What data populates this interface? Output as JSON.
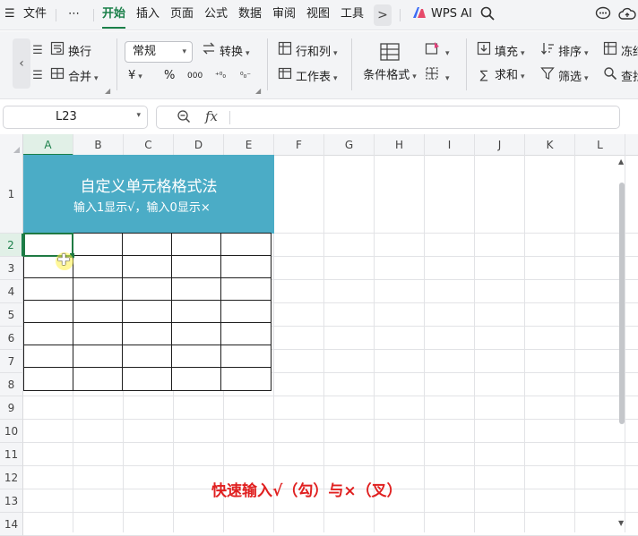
{
  "menu": {
    "items": [
      {
        "label": "文件",
        "name": "menu-file"
      },
      {
        "label": "开始",
        "name": "tab-home",
        "active": true
      },
      {
        "label": "插入",
        "name": "tab-insert"
      },
      {
        "label": "页面",
        "name": "tab-page"
      },
      {
        "label": "公式",
        "name": "tab-formula"
      },
      {
        "label": "数据",
        "name": "tab-data"
      },
      {
        "label": "审阅",
        "name": "tab-review"
      },
      {
        "label": "视图",
        "name": "tab-view"
      },
      {
        "label": "工具",
        "name": "tab-tools"
      }
    ],
    "more_label": "⋯",
    "overflow_label": ">",
    "wps_ai_label": "WPS AI"
  },
  "ribbon": {
    "wrap_label": "换行",
    "merge_label": "合并",
    "number_format": "常规",
    "convert_label": "转换",
    "rows_cols_label": "行和列",
    "worksheet_label": "工作表",
    "cond_format_label": "条件格式",
    "fill_label": "填充",
    "sum_label": "求和",
    "sort_label": "排序",
    "filter_label": "筛选",
    "freeze_label": "冻结",
    "find_label": "查找",
    "currency_symbol": "¥",
    "percent_symbol": "%",
    "thousands_symbol": "000"
  },
  "formula_bar": {
    "cell_ref": "L23",
    "fx_label": "fx",
    "content": ""
  },
  "sheet": {
    "columns": [
      "A",
      "B",
      "C",
      "D",
      "E",
      "F",
      "G",
      "H",
      "I",
      "J",
      "K",
      "L"
    ],
    "rows": [
      "1",
      "2",
      "3",
      "4",
      "5",
      "6",
      "7",
      "8",
      "9",
      "10",
      "11",
      "12",
      "13",
      "14"
    ],
    "title": "自定义单元格格式法",
    "subtitle": "输入1显示√，输入0显示×",
    "caption": "快速输入√（勾）与×（叉）"
  },
  "colors": {
    "accent": "#1a7f49",
    "title_fill": "#4bacc6",
    "caption": "#e02020"
  }
}
